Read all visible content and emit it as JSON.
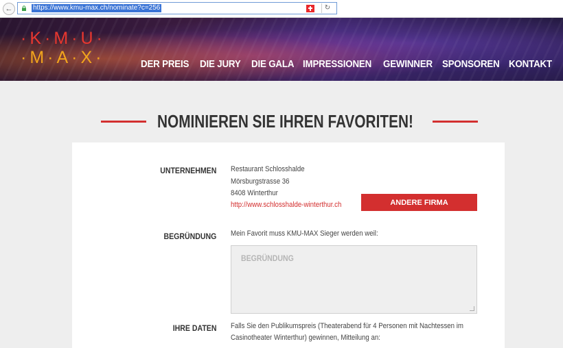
{
  "browser": {
    "url": "https://www.kmu-max.ch/nominate?c=256",
    "back_symbol": "←",
    "reload_symbol": "↻"
  },
  "logo": {
    "row1": "·K·M·U·",
    "row2": "·M·A·X·"
  },
  "nav": [
    "DER PREIS",
    "DIE JURY",
    "DIE GALA",
    "IMPRESSIONEN",
    "GEWINNER",
    "SPONSOREN",
    "KONTAKT"
  ],
  "page_title": "NOMINIEREN SIE IHREN FAVORITEN!",
  "form": {
    "company_label": "UNTERNEHMEN",
    "company": {
      "name": "Restaurant Schlosshalde",
      "street": "Mörsburgstrasse 36",
      "city": "8408 Winterthur",
      "website": "http://www.schlosshalde-winterthur.ch"
    },
    "other_company_button": "ANDERE FIRMA",
    "reason_label": "BEGRÜNDUNG",
    "reason_intro": "Mein Favorit muss KMU-MAX Sieger werden weil:",
    "reason_placeholder": "BEGRÜNDUNG",
    "your_data_label": "IHRE DATEN",
    "your_data_line1": "Falls Sie den Publikumspreis (Theaterabend für 4 Personen mit Nachtessen im",
    "your_data_line2": "Casinotheater Winterthur) gewinnen, Mitteilung an:"
  },
  "colors": {
    "accent_red": "#d32f2f",
    "logo_red": "#e8372f",
    "logo_orange": "#f2a51d",
    "background": "#eeeeee"
  }
}
